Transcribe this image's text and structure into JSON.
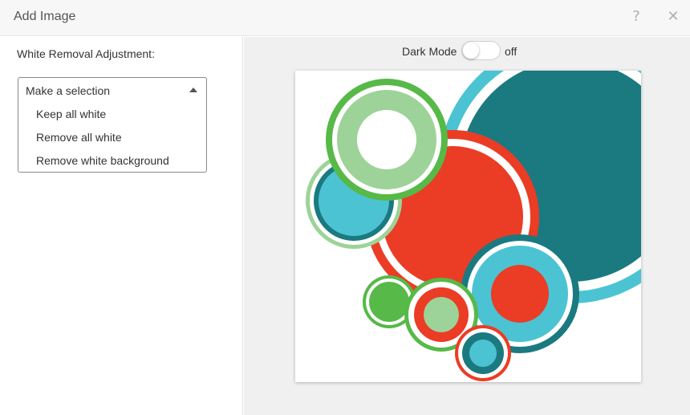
{
  "dialog": {
    "title": "Add Image",
    "help_label": "?",
    "close_label": "✕"
  },
  "left_panel": {
    "label": "White Removal Adjustment:",
    "select": {
      "placeholder": "Make a selection",
      "options": [
        "Keep all white",
        "Remove all white",
        "Remove white background"
      ]
    }
  },
  "right_panel": {
    "dark_mode": {
      "label": "Dark Mode",
      "state": "off"
    },
    "preview_image": {
      "alt": "Concentric colored circles artwork",
      "colors": {
        "teal_dark": "#1a7a80",
        "teal_light": "#4cc3d2",
        "red": "#eb3c25",
        "green": "#57b947",
        "green_light": "#9dd398",
        "white": "#ffffff"
      }
    }
  },
  "icons": [
    "help-icon",
    "close-icon",
    "caret-up-icon"
  ]
}
